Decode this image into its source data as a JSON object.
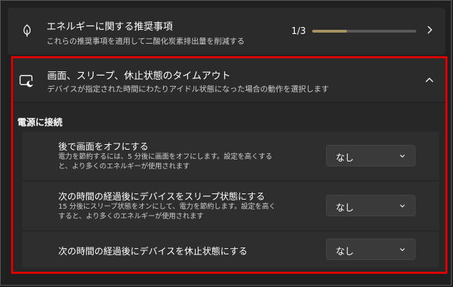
{
  "energy": {
    "title": "エネルギーに関する推奨事項",
    "description": "これらの推奨事項を適用して二酸化炭素排出量を削減する",
    "count": "1/3",
    "progress": 0.33
  },
  "screen_sleep": {
    "title": "画面、スリープ、休止状態のタイムアウト",
    "description": "デバイスが指定された時間にわたりアイドル状態になった場合の動作を選択します",
    "section_title": "電源に接続",
    "rows": [
      {
        "label": "後で画面をオフにする",
        "sub": "電力を節約するには、5 分後に画面をオフにします。設定を高くすると、より多くのエネルギーが使用されます",
        "value": "なし"
      },
      {
        "label": "次の時間の経過後にデバイスをスリープ状態にする",
        "sub": "15 分後にスリープ状態をオンにして、電力を節約します。設定を高くすると、より多くのエネルギーが使用されます",
        "value": "なし"
      },
      {
        "label": "次の時間の経過後にデバイスを休止状態にする",
        "sub": "",
        "value": "なし"
      }
    ]
  },
  "icons": {
    "energy": "leaf-icon",
    "screen_sleep": "screen-moon-icon",
    "expand_right": "chevron-right-icon",
    "collapse": "chevron-up-icon",
    "dropdown": "chevron-down-icon"
  },
  "colors": {
    "background": "#202020",
    "card": "#2b2b2b",
    "progress_fill": "#a89563",
    "highlight": "#e00000"
  }
}
